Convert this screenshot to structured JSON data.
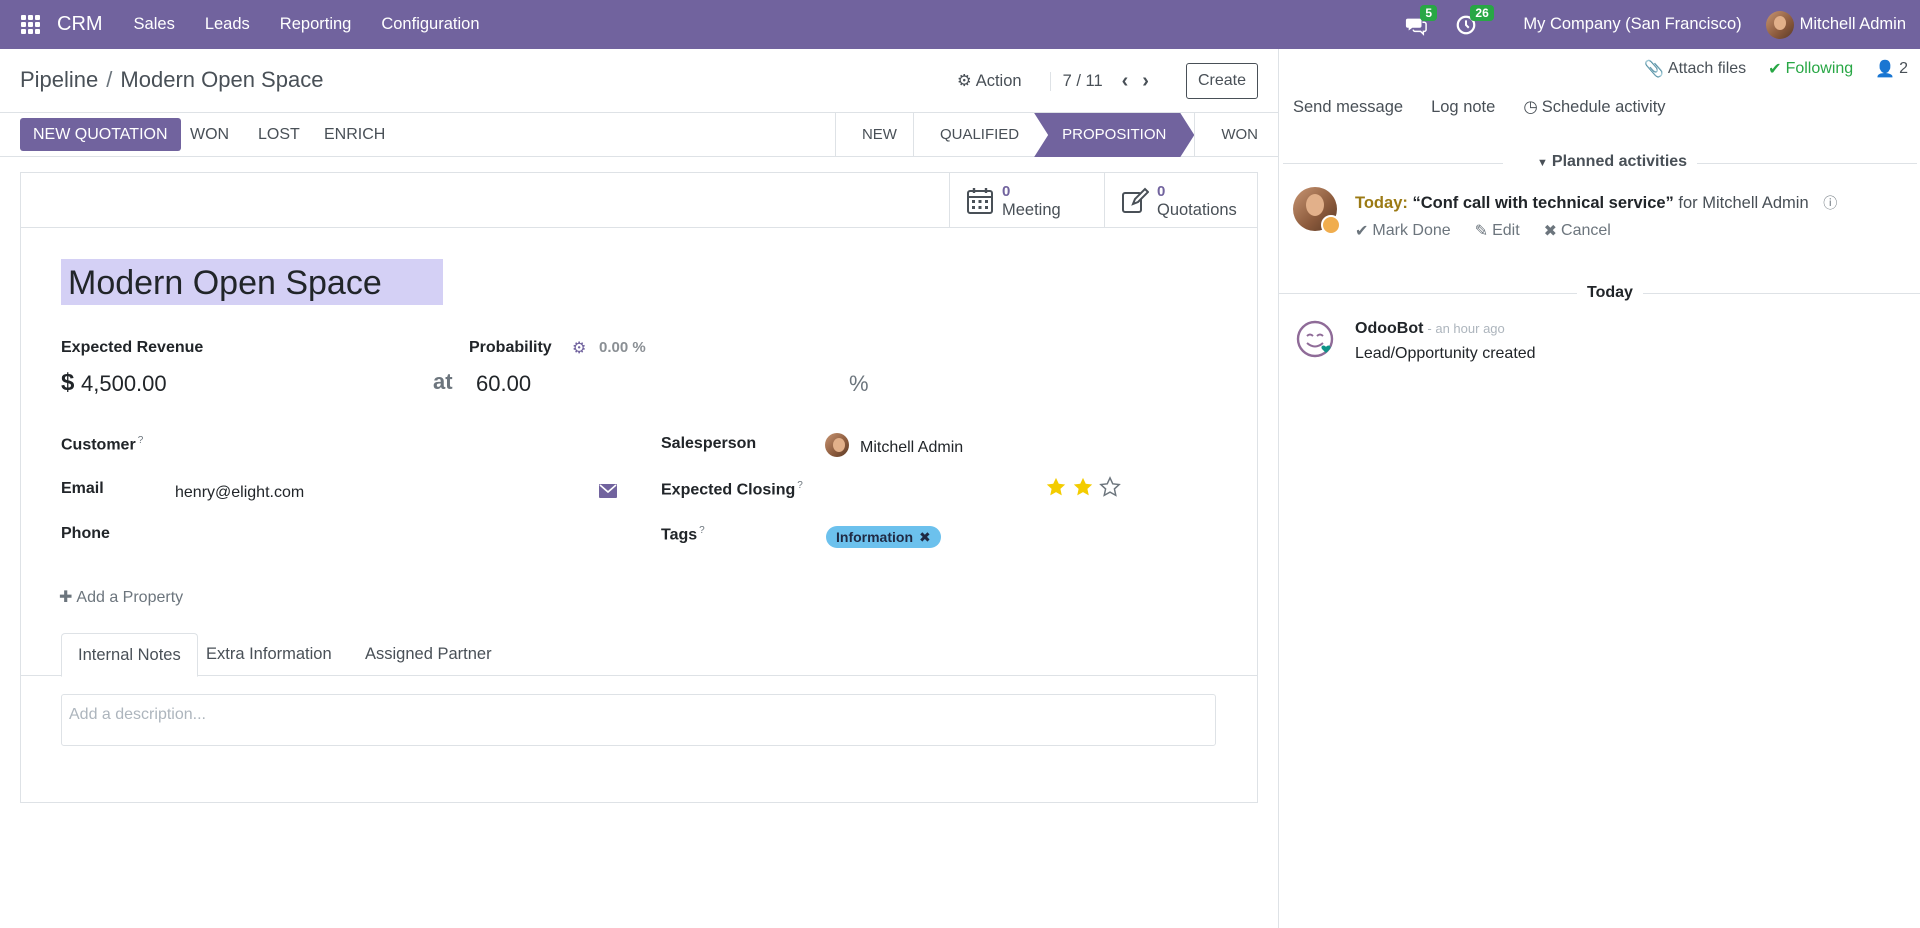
{
  "navbar": {
    "brand": "CRM",
    "menu": [
      "Sales",
      "Leads",
      "Reporting",
      "Configuration"
    ],
    "messages_count": "5",
    "activities_count": "26",
    "company": "My Company (San Francisco)",
    "user": "Mitchell Admin"
  },
  "control_panel": {
    "breadcrumb_parent": "Pipeline",
    "breadcrumb_sep": "/",
    "breadcrumb_current": "Modern Open Space",
    "action_label": "Action",
    "pager": "7 / 11",
    "create_label": "Create"
  },
  "status_bar": {
    "buttons": [
      "NEW QUOTATION",
      "WON",
      "LOST",
      "ENRICH"
    ],
    "stages": [
      "NEW",
      "QUALIFIED",
      "PROPOSITION",
      "WON"
    ],
    "active_stage": "PROPOSITION"
  },
  "smart_buttons": [
    {
      "value": "0",
      "label": "Meeting",
      "icon": "calendar-icon"
    },
    {
      "value": "0",
      "label": "Quotations",
      "icon": "edit-icon"
    }
  ],
  "form": {
    "title": "Modern Open Space",
    "expected_revenue_label": "Expected Revenue",
    "currency": "$",
    "expected_revenue": "4,500.00",
    "at_label": "at",
    "probability_label": "Probability",
    "auto_probability": "0.00 %",
    "probability": "60.00",
    "percent": "%",
    "customer_label": "Customer",
    "email_label": "Email",
    "email": "henry@elight.com",
    "phone_label": "Phone",
    "salesperson_label": "Salesperson",
    "salesperson": "Mitchell Admin",
    "expected_closing_label": "Expected Closing",
    "priority": 2,
    "priority_max": 3,
    "tags_label": "Tags",
    "tag": "Information",
    "add_property": "Add a Property",
    "help_mark": "?"
  },
  "tabs": [
    "Internal Notes",
    "Extra Information",
    "Assigned Partner"
  ],
  "description_placeholder": "Add a description...",
  "chatter": {
    "attach_files": "Attach files",
    "following": "Following",
    "followers": "2",
    "send_message": "Send message",
    "log_note": "Log note",
    "schedule_activity": "Schedule activity",
    "planned_activities": "Planned activities",
    "activity": {
      "when": "Today:",
      "summary": "“Conf call with technical service”",
      "for": "for Mitchell Admin",
      "mark_done": "Mark Done",
      "edit": "Edit",
      "cancel": "Cancel"
    },
    "today_label": "Today",
    "message": {
      "author": "OdooBot",
      "time": "- an hour ago",
      "body": "Lead/Opportunity created"
    }
  },
  "colors": {
    "brand": "#71639e",
    "tag": "#6cc1ed",
    "star": "#f3cc00",
    "following": "#28a745"
  }
}
